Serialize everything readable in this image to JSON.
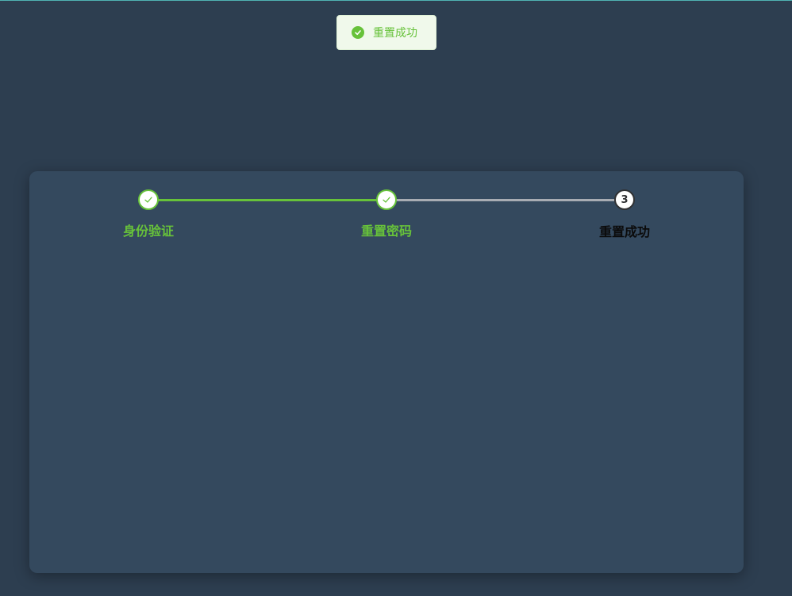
{
  "notification": {
    "icon": "success-check-circle-icon",
    "message": "重置成功",
    "color": "#67c23a"
  },
  "steps": [
    {
      "label": "身份验证",
      "status": "success",
      "icon": "check-icon"
    },
    {
      "label": "重置密码",
      "status": "success",
      "icon": "check-icon"
    },
    {
      "label": "重置成功",
      "status": "process",
      "number": "3"
    }
  ],
  "colors": {
    "background": "#2d3e50",
    "card": "#34495e",
    "success": "#67c23a",
    "pending_line": "#a8acb3",
    "active_text": "#0b0b0b"
  }
}
